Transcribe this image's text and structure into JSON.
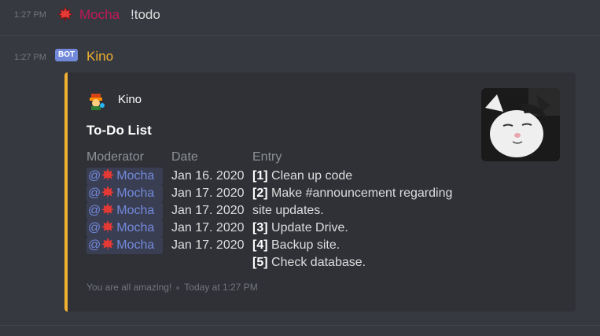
{
  "message1": {
    "time": "1:27 PM",
    "username": "Mocha",
    "username_color": "#c2185b",
    "text": "!todo",
    "icon": "maple-leaf-icon"
  },
  "message2": {
    "time": "1:27 PM",
    "bot_tag": "BOT",
    "username": "Kino",
    "username_color": "#f0b132"
  },
  "embed": {
    "accent_color": "#f0b132",
    "author": "Kino",
    "title": "To-Do List",
    "columns": [
      "Moderator",
      "Date",
      "Entry"
    ],
    "moderators": [
      {
        "at": "@",
        "name": "Mocha"
      },
      {
        "at": "@",
        "name": "Mocha"
      },
      {
        "at": "@",
        "name": "Mocha"
      },
      {
        "at": "@",
        "name": "Mocha"
      },
      {
        "at": "@",
        "name": "Mocha"
      }
    ],
    "dates": [
      "Jan 16. 2020",
      "Jan 17. 2020",
      "Jan 17. 2020",
      "Jan 17. 2020",
      "Jan 17. 2020"
    ],
    "entries": [
      {
        "num": "[1]",
        "text": " Clean up code"
      },
      {
        "num": "[2]",
        "text": " Make #announcement regarding"
      },
      {
        "num": "",
        "text": "site updates."
      },
      {
        "num": "[3]",
        "text": " Update Drive."
      },
      {
        "num": "[4]",
        "text": " Backup site."
      },
      {
        "num": "[5]",
        "text": " Check database."
      }
    ],
    "footer_text": "You are all amazing!",
    "footer_time": "Today at 1:27 PM",
    "thumbnail": "cat-thumbnail"
  }
}
